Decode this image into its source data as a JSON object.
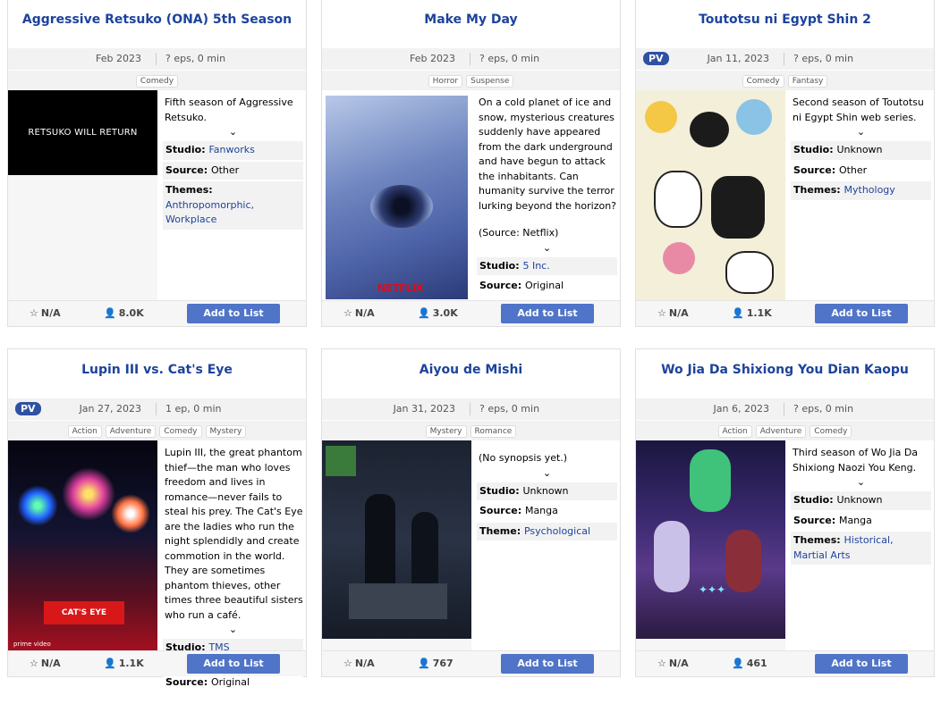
{
  "add_label": "Add to List",
  "cards": [
    {
      "title": "Aggressive Retsuko (ONA) 5th Season",
      "date": "Feb 2023",
      "eps": "? eps, 0 min",
      "genres": [
        "Comedy"
      ],
      "synopsis": "Fifth season of Aggressive Retsuko.",
      "image_text": "RETSUKO WILL RETURN",
      "studio": "Fanworks",
      "source": "Other",
      "themes": "Anthropomorphic, Workplace",
      "score": "N/A",
      "members": "8.0K"
    },
    {
      "title": "Make My Day",
      "date": "Feb 2023",
      "eps": "? eps, 0 min",
      "genres": [
        "Horror",
        "Suspense"
      ],
      "synopsis": "On a cold planet of ice and snow, mysterious creatures suddenly have appeared from the dark underground and have begun to attack the inhabitants. Can humanity survive the terror lurking beyond the horizon?",
      "synopsis_source": "(Source: Netflix)",
      "image_text": "NETFLIX",
      "studio": "5 Inc.",
      "source": "Original",
      "score": "N/A",
      "members": "3.0K"
    },
    {
      "title": "Toutotsu ni Egypt Shin 2",
      "pv": "PV",
      "date": "Jan 11, 2023",
      "eps": "? eps, 0 min",
      "genres": [
        "Comedy",
        "Fantasy"
      ],
      "synopsis": "Second season of Toutotsu ni Egypt Shin web series.",
      "studio": "Unknown",
      "source": "Other",
      "themes": "Mythology",
      "score": "N/A",
      "members": "1.1K"
    },
    {
      "title": "Lupin III vs. Cat's Eye",
      "pv": "PV",
      "date": "Jan 27, 2023",
      "eps": "1 ep, 0 min",
      "genres": [
        "Action",
        "Adventure",
        "Comedy",
        "Mystery"
      ],
      "synopsis": "Lupin III, the great phantom thief—the man who loves freedom and lives in romance—never fails to steal his prey. The Cat's Eye are the ladies who run the night splendidly and create commotion in the world. They are sometimes phantom thieves, other times three beautiful sisters who run a café.",
      "image_text": "prime video",
      "studio": "TMS Entertainment",
      "source": "Original",
      "score": "N/A",
      "members": "1.1K"
    },
    {
      "title": "Aiyou de Mishi",
      "date": "Jan 31, 2023",
      "eps": "? eps, 0 min",
      "genres": [
        "Mystery",
        "Romance"
      ],
      "synopsis": "(No synopsis yet.)",
      "studio": "Unknown",
      "source": "Manga",
      "themes": "Psychological",
      "score": "N/A",
      "members": "767"
    },
    {
      "title": "Wo Jia Da Shixiong You Dian Kaopu",
      "date": "Jan 6, 2023",
      "eps": "? eps, 0 min",
      "genres": [
        "Action",
        "Adventure",
        "Comedy"
      ],
      "synopsis": "Third season of Wo Jia Da Shixiong Naozi You Keng.",
      "studio": "Unknown",
      "source": "Manga",
      "themes": "Historical, Martial Arts",
      "score": "N/A",
      "members": "461"
    }
  ]
}
